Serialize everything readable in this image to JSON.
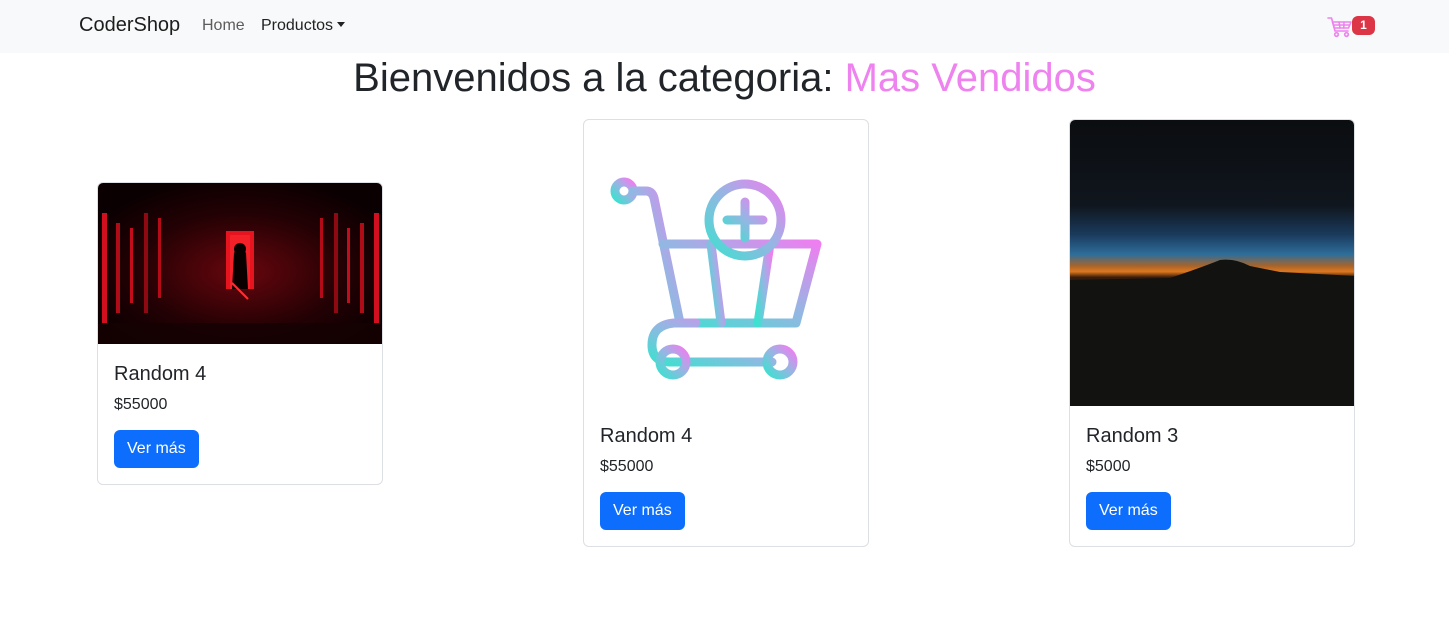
{
  "navbar": {
    "brand": "CoderShop",
    "links": [
      {
        "label": "Home"
      },
      {
        "label": "Productos",
        "dropdown": true
      }
    ],
    "cart": {
      "icon": "shopping-cart-icon",
      "count": "1",
      "icon_color": "#ee82ee",
      "badge_color": "#dc3545"
    }
  },
  "heading": {
    "prefix": "Bienvenidos a la categoria:",
    "category": "Mas Vendidos",
    "category_color": "#ee82ee"
  },
  "products": [
    {
      "title": "Random 4",
      "price": "$55000",
      "button": "Ver más",
      "image": "dark-red-corridor-photo"
    },
    {
      "title": "Random 4",
      "price": "$55000",
      "button": "Ver más",
      "image": "gradient-cart-plus-icon"
    },
    {
      "title": "Random 3",
      "price": "$5000",
      "button": "Ver más",
      "image": "sunset-horizon-photo"
    }
  ],
  "colors": {
    "primary_button": "#0d6efd",
    "navbar_bg": "#f8f9fa"
  }
}
